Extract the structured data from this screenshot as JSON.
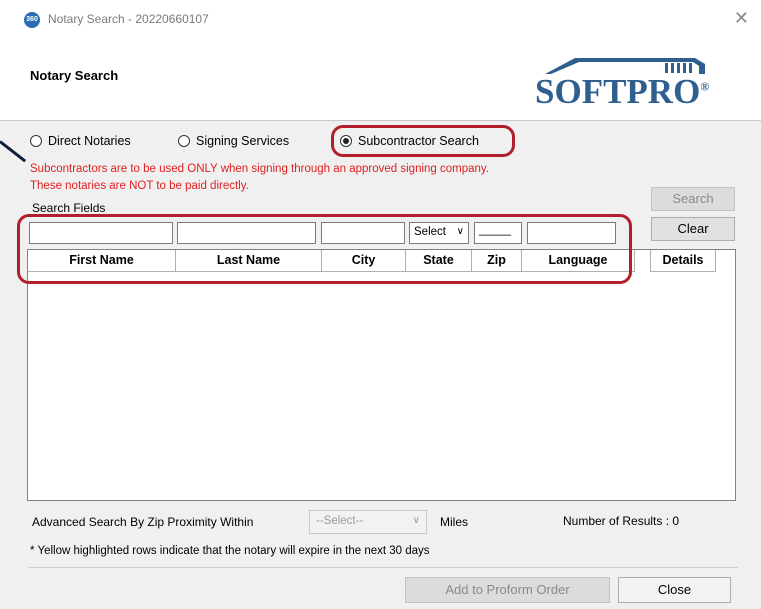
{
  "window": {
    "icon_text": "360",
    "title": "Notary Search - 20220660107",
    "close_glyph": "✕"
  },
  "header": {
    "title": "Notary Search",
    "logo_text": "SOFTPRO",
    "logo_mark": "®"
  },
  "search_type": {
    "options": [
      {
        "label": "Direct Notaries",
        "selected": false
      },
      {
        "label": "Signing Services",
        "selected": false
      },
      {
        "label": "Subcontractor Search",
        "selected": true
      }
    ]
  },
  "warning": {
    "line1": "Subcontractors are to be used ONLY when signing through an approved signing company.",
    "line2": "These notaries are NOT to be paid directly."
  },
  "search_fields": {
    "label": "Search Fields",
    "first_name": "",
    "last_name": "",
    "city": "",
    "state_select": "Select",
    "zip": "_____",
    "language": ""
  },
  "buttons": {
    "search": "Search",
    "clear": "Clear",
    "add_to_proform": "Add to Proform Order",
    "close": "Close"
  },
  "grid": {
    "columns": [
      "First Name",
      "Last Name",
      "City",
      "State",
      "Zip",
      "Language",
      "Details"
    ],
    "rows": []
  },
  "advanced": {
    "label": "Advanced Search By Zip Proximity Within",
    "select_value": "--Select--",
    "unit": "Miles",
    "results_label": "Number of Results : 0"
  },
  "note": "* Yellow highlighted rows indicate that the notary will expire in the next 30 days",
  "colors": {
    "warning_red": "#e02020",
    "annotation_oval": "#b21e2b",
    "logo_blue": "#2f5f8e"
  }
}
